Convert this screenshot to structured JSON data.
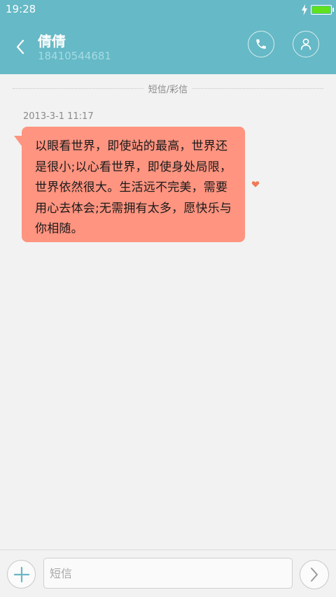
{
  "status_bar": {
    "time": "19:28",
    "charging_icon": "bolt-icon",
    "battery_icon": "battery-icon",
    "battery_color": "#5fe11e"
  },
  "header": {
    "background_color": "#66b9c6",
    "back_icon": "chevron-left-icon",
    "contact_name": "倩倩",
    "contact_number": "18410544681",
    "call_icon": "phone-icon",
    "contact_icon": "person-icon"
  },
  "conversation": {
    "message_type_label": "短信/彩信",
    "messages": [
      {
        "timestamp": "2013-3-1 11:17",
        "text": "以眼看世界，即使站的最高，世界还是很小;以心看世界，即使身处局限，世界依然很大。生活远不完美，需要用心去体会;无需拥有太多，愿快乐与你相随。",
        "bubble_color": "#ff9480",
        "status_icon": "heart-icon",
        "status_color": "#f07a56"
      }
    ]
  },
  "composer": {
    "add_icon": "plus-icon",
    "input_placeholder": "短信",
    "input_value": "",
    "send_icon": "chevron-right-icon"
  }
}
